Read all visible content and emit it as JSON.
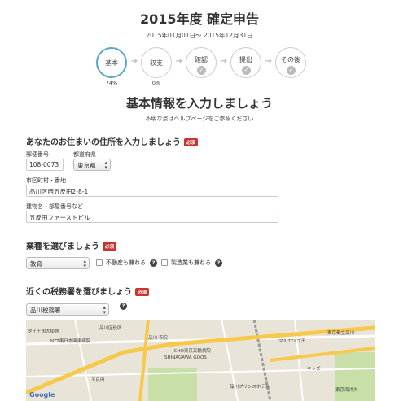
{
  "header": {
    "title": "2015年度 確定申告",
    "period": "2015年01月01日〜 2015年12月31日"
  },
  "steps": [
    {
      "label": "基本",
      "percent": "74%",
      "active": true
    },
    {
      "label": "収支",
      "percent": "0%",
      "active": false
    },
    {
      "label": "確認",
      "percent": "",
      "active": false
    },
    {
      "label": "提出",
      "percent": "",
      "active": false
    },
    {
      "label": "その後",
      "percent": "",
      "active": false
    }
  ],
  "page": {
    "heading": "基本情報を入力しましょう",
    "note": "不明な点はヘルプページをご参照ください"
  },
  "address": {
    "heading": "あなたのお住まいの住所を入力しましょう",
    "required": "必須",
    "postal_label": "郵便番号",
    "postal_value": "108-0073",
    "pref_label": "都道府県",
    "pref_value": "東京都",
    "city_label": "市区町村・番地",
    "city_value": "品川区西五反田2-8-1",
    "building_label": "建物名・部屋番号など",
    "building_value": "五反田ファーストビル"
  },
  "industry": {
    "heading": "業種を選びましょう",
    "required": "必須",
    "select_value": "教育",
    "realestate_label": "不動産も兼ねる",
    "manufacturing_label": "製造業も兼ねる",
    "help": "?"
  },
  "tax_office": {
    "heading": "近くの税務署を選びましょう",
    "required": "必須",
    "select_value": "品川税務署",
    "help": "?"
  },
  "map": {
    "labels": [
      "タイ王国大使館",
      "NTT東日本関東病院",
      "品川区役所",
      "品川 寺院",
      "五反田",
      "SHINAGAWA GOOS",
      "JCHO東京高輪病院",
      "マルエツプチ",
      "東京都立品川",
      "品川プリンスホテル",
      "キッズ",
      "Google",
      "東京海洋大"
    ],
    "colors": {
      "road_major": "#f7c84a",
      "road_minor": "#ffffff",
      "park": "#c8dfa8",
      "rail": "#9a9a9a",
      "ground": "#e8e4d8"
    }
  },
  "icons": {
    "check": "✓",
    "arrow": "➔",
    "caret": "▴▾"
  }
}
